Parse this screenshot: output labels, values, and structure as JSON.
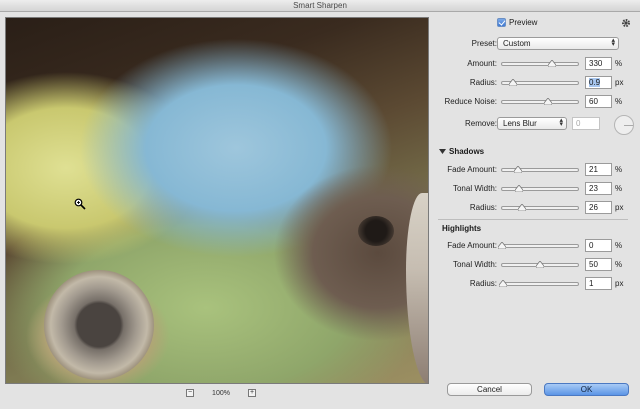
{
  "window": {
    "title": "Smart Sharpen"
  },
  "preview_checkbox": {
    "label": "Preview",
    "checked": true
  },
  "preset": {
    "label": "Preset:",
    "value": "Custom"
  },
  "main": {
    "amount": {
      "label": "Amount:",
      "value": "330",
      "unit": "%",
      "fraction": 0.66
    },
    "radius": {
      "label": "Radius:",
      "value": "0.9",
      "unit": "px",
      "fraction": 0.15
    },
    "reduce_noise": {
      "label": "Reduce Noise:",
      "value": "60",
      "unit": "%",
      "fraction": 0.6
    },
    "remove": {
      "label": "Remove:",
      "value": "Lens Blur",
      "angle_value": "0"
    }
  },
  "shadows": {
    "title": "Shadows",
    "fade_amount": {
      "label": "Fade Amount:",
      "value": "21",
      "unit": "%",
      "fraction": 0.21
    },
    "tonal_width": {
      "label": "Tonal Width:",
      "value": "23",
      "unit": "%",
      "fraction": 0.23
    },
    "radius": {
      "label": "Radius:",
      "value": "26",
      "unit": "px",
      "fraction": 0.26
    }
  },
  "highlights": {
    "title": "Highlights",
    "fade_amount": {
      "label": "Fade Amount:",
      "value": "0",
      "unit": "%",
      "fraction": 0.0
    },
    "tonal_width": {
      "label": "Tonal Width:",
      "value": "50",
      "unit": "%",
      "fraction": 0.5
    },
    "radius": {
      "label": "Radius:",
      "value": "1",
      "unit": "px",
      "fraction": 0.01
    }
  },
  "zoom": {
    "value": "100%",
    "minus": "−",
    "plus": "+"
  },
  "buttons": {
    "cancel": "Cancel",
    "ok": "OK"
  },
  "icons": {
    "gear": "gear-icon",
    "zoom_cursor": "zoom-in-cursor-icon",
    "collapse": "triangle-down-icon"
  }
}
